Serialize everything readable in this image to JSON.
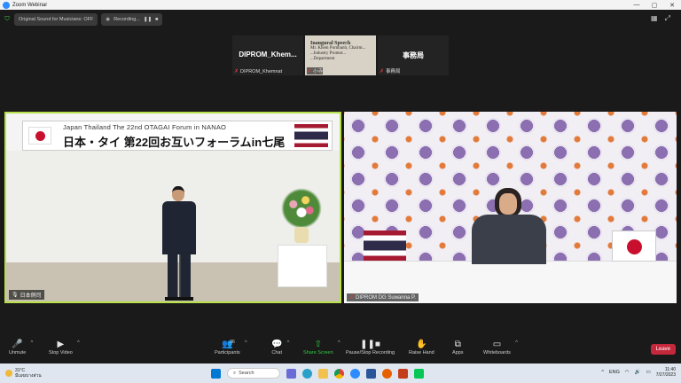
{
  "window": {
    "title": "Zoom Webinar",
    "controls": [
      "—",
      "▢",
      "✕"
    ]
  },
  "topbar": {
    "audio_label": "Original Sound for Musicians: OFF",
    "recording_label": "Recording...",
    "view_icons": [
      "grid-icon",
      "fullscreen-icon"
    ]
  },
  "thumbnails": [
    {
      "display_text": "DIPROM_Khem...",
      "name": "DIPROM_Khemnat",
      "muted": true
    },
    {
      "display_text": "",
      "name": "小寺",
      "muted": true,
      "slide": {
        "title": "Inaugural Speech",
        "lines": [
          "Mr. Khem Pornbanh, Chairm...",
          "...Industry Promot...",
          "...Department"
        ]
      }
    },
    {
      "display_text": "事務局",
      "name": "事務局",
      "muted": true
    }
  ],
  "main_left": {
    "banner_en": "Japan Thailand The 22nd OTAGAI Forum in NANAO",
    "banner_jp": "日本・タイ 第22回お互いフォーラムin七尾",
    "label": "日本側司"
  },
  "main_right": {
    "label": "DIPROM DG Suwanna P."
  },
  "toolbar": {
    "unmute": "Unmute",
    "stop_video": "Stop Video",
    "participants": "Participants",
    "participants_count": "36",
    "chat": "Chat",
    "share_screen": "Share Screen",
    "pause_recording": "Pause/Stop Recording",
    "raise_hand": "Raise Hand",
    "apps": "Apps",
    "whiteboards": "Whiteboards",
    "leave": "Leave"
  },
  "taskbar": {
    "temp": "31°C",
    "weather_text": "มีเมฆบางส่วน",
    "search": "Search",
    "lang": "ENG",
    "time": "11:40",
    "date": "7/27/2023"
  },
  "colors": {
    "active_speaker_border": "#b8e04a",
    "share_green": "#2ecc40",
    "leave_red": "#c6283b"
  }
}
